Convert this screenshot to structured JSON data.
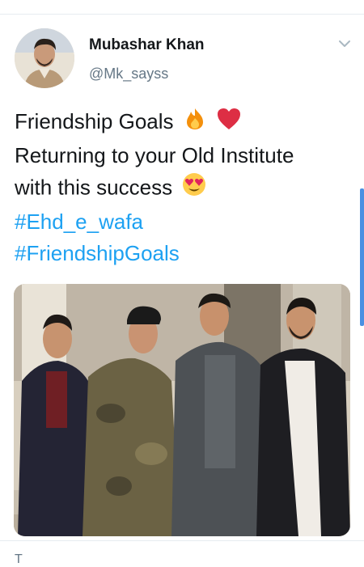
{
  "tweet": {
    "author_name": "Mubashar Khan",
    "author_handle": "@Mk_sayss",
    "line1": "Friendship Goals",
    "line2": "Returning to your Old Institute",
    "line3": "with this success",
    "hashtags": [
      "#Ehd_e_wafa",
      "#FriendshipGoals"
    ],
    "emojis": [
      "fire-emoji",
      "red-heart-emoji",
      "heart-eyes-emoji"
    ]
  },
  "icons": {
    "menu": "chevron-down-icon"
  },
  "colors": {
    "hashtag": "#1da1f2",
    "handle": "#657786",
    "scroll_indicator": "#4a90e2"
  },
  "next_tweet_preview": "T"
}
